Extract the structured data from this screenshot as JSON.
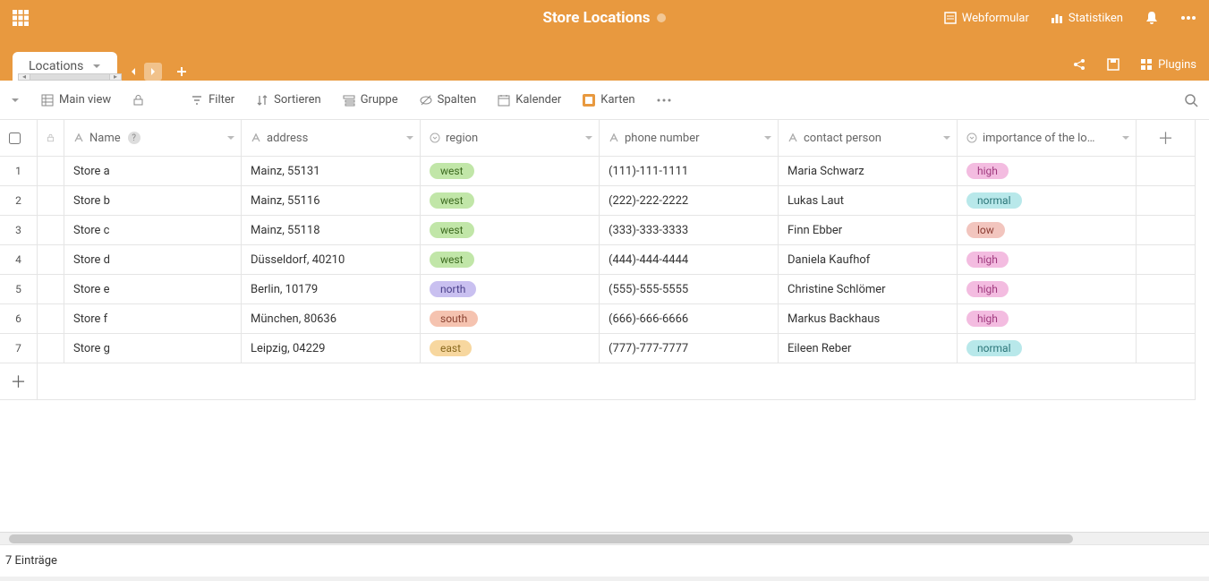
{
  "header": {
    "title": "Store Locations",
    "webform": "Webformular",
    "stats": "Statistiken",
    "plugins": "Plugins"
  },
  "tabs": {
    "active": "Locations"
  },
  "toolbar": {
    "main_view": "Main view",
    "filter": "Filter",
    "sort": "Sortieren",
    "group": "Gruppe",
    "columns": "Spalten",
    "calendar": "Kalender",
    "cards": "Karten"
  },
  "columns": {
    "name": "Name",
    "address": "address",
    "region": "region",
    "phone": "phone number",
    "contact": "contact person",
    "importance": "importance of the lo…"
  },
  "rows": [
    {
      "num": "1",
      "name": "Store a",
      "address": "Mainz, 55131",
      "region": "west",
      "phone": "(111)-111-1111",
      "contact": "Maria Schwarz",
      "importance": "high"
    },
    {
      "num": "2",
      "name": "Store b",
      "address": "Mainz, 55116",
      "region": "west",
      "phone": "(222)-222-2222",
      "contact": "Lukas Laut",
      "importance": "normal"
    },
    {
      "num": "3",
      "name": "Store c",
      "address": "Mainz, 55118",
      "region": "west",
      "phone": "(333)-333-3333",
      "contact": "Finn Ebber",
      "importance": "low"
    },
    {
      "num": "4",
      "name": "Store d",
      "address": "Düsseldorf, 40210",
      "region": "west",
      "phone": "(444)-444-4444",
      "contact": "Daniela Kaufhof",
      "importance": "high"
    },
    {
      "num": "5",
      "name": "Store e",
      "address": "Berlin, 10179",
      "region": "north",
      "phone": "(555)-555-5555",
      "contact": "Christine Schlömer",
      "importance": "high"
    },
    {
      "num": "6",
      "name": "Store f",
      "address": "München, 80636",
      "region": "south",
      "phone": "(666)-666-6666",
      "contact": "Markus Backhaus",
      "importance": "high"
    },
    {
      "num": "7",
      "name": "Store g",
      "address": "Leipzig, 04229",
      "region": "east",
      "phone": "(777)-777-7777",
      "contact": "Eileen Reber",
      "importance": "normal"
    }
  ],
  "footer": {
    "entries": "7 Einträge"
  }
}
